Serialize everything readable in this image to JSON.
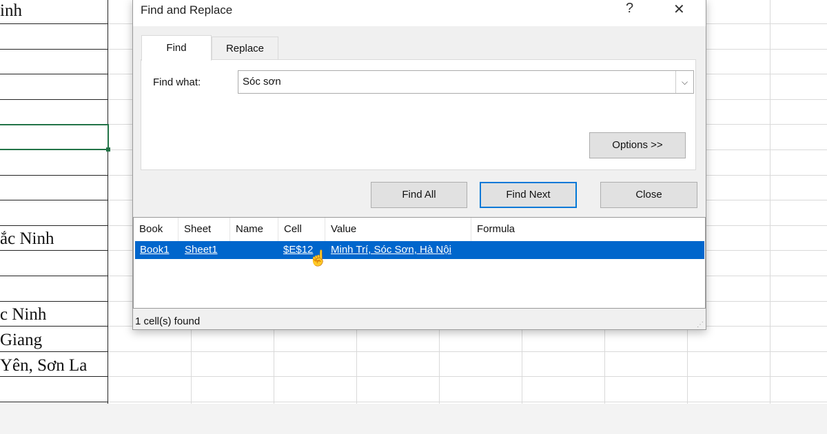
{
  "sheet": {
    "cells": [
      {
        "text": "inh",
        "row": 0
      },
      {
        "text": "ắc Ninh",
        "row": 9
      },
      {
        "text": "c Ninh",
        "row": 12
      },
      {
        "text": "Giang",
        "row": 13
      },
      {
        "text": "Yên, Sơn La",
        "row": 14
      }
    ]
  },
  "dialog": {
    "title": "Find and Replace",
    "help": "?",
    "close_x": "✕",
    "tabs": [
      {
        "label": "Find",
        "active": true
      },
      {
        "label": "Replace",
        "active": false
      }
    ],
    "find_what_label": "Find what:",
    "find_what_value": "Sóc sơn",
    "options_button": "Options >>",
    "find_all_button": "Find All",
    "find_next_button": "Find Next",
    "close_button": "Close",
    "results": {
      "columns": [
        "Book",
        "Sheet",
        "Name",
        "Cell",
        "Value",
        "Formula"
      ],
      "rows": [
        {
          "book": "Book1",
          "sheet": "Sheet1",
          "name": "",
          "cell": "$E$12",
          "value": "Minh Trí, Sóc Sơn, Hà Nội",
          "formula": ""
        }
      ]
    },
    "status": "1 cell(s) found"
  }
}
